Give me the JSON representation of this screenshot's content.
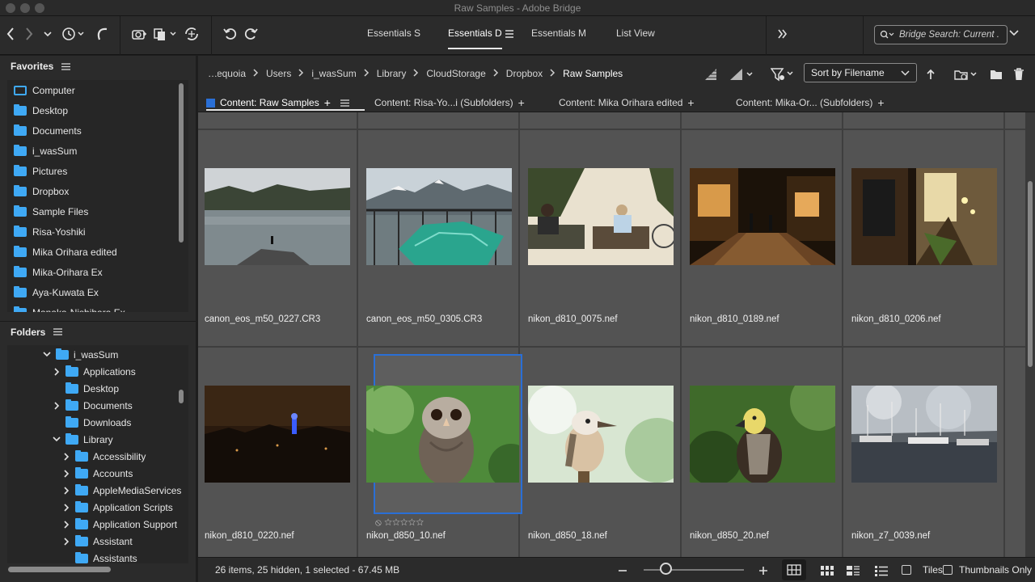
{
  "window": {
    "title": "Raw Samples - Adobe Bridge"
  },
  "toolbar": {
    "workspaces": [
      {
        "label": "Essentials S"
      },
      {
        "label": "Essentials D"
      },
      {
        "label": "Essentials M"
      },
      {
        "label": "List View"
      }
    ],
    "search_placeholder": "Bridge Search: Current ."
  },
  "favorites": {
    "title": "Favorites",
    "items": [
      {
        "label": "Computer",
        "icon": "computer-icon"
      },
      {
        "label": "Desktop",
        "icon": "folder-icon"
      },
      {
        "label": "Documents",
        "icon": "folder-icon"
      },
      {
        "label": "i_wasSum",
        "icon": "home-folder-icon"
      },
      {
        "label": "Pictures",
        "icon": "folder-icon"
      },
      {
        "label": "Dropbox",
        "icon": "folder-icon"
      },
      {
        "label": "Sample Files",
        "icon": "folder-icon"
      },
      {
        "label": "Risa-Yoshiki",
        "icon": "folder-icon"
      },
      {
        "label": "Mika Orihara edited",
        "icon": "folder-icon"
      },
      {
        "label": "Mika-Orihara Ex",
        "icon": "folder-icon"
      },
      {
        "label": "Aya-Kuwata Ex",
        "icon": "folder-icon"
      },
      {
        "label": "Manaka-Nishihara Ex",
        "icon": "folder-icon"
      }
    ]
  },
  "folders": {
    "title": "Folders",
    "items": [
      {
        "label": "i_wasSum",
        "expanded": true
      },
      {
        "label": "Applications",
        "expanded": false
      },
      {
        "label": "Desktop",
        "expanded": null
      },
      {
        "label": "Documents",
        "expanded": false
      },
      {
        "label": "Downloads",
        "expanded": null
      },
      {
        "label": "Library",
        "expanded": true
      },
      {
        "label": "Accessibility",
        "expanded": false
      },
      {
        "label": "Accounts",
        "expanded": false
      },
      {
        "label": "AppleMediaServices",
        "expanded": false
      },
      {
        "label": "Application Scripts",
        "expanded": false
      },
      {
        "label": "Application Support",
        "expanded": false
      },
      {
        "label": "Assistant",
        "expanded": false
      },
      {
        "label": "Assistants",
        "expanded": null
      }
    ]
  },
  "breadcrumb": [
    "Sequoia",
    "Users",
    "i_wasSum",
    "Library",
    "CloudStorage",
    "Dropbox",
    "Raw Samples"
  ],
  "sort": {
    "label": "Sort by Filename"
  },
  "content_tabs": [
    {
      "label": "Content: Raw Samples"
    },
    {
      "label": "Content: Risa-Yo...i (Subfolders)"
    },
    {
      "label": "Content: Mika Orihara edited"
    },
    {
      "label": "Content: Mika-Or... (Subfolders)"
    }
  ],
  "thumbnails": [
    {
      "filename": "canon_eos_m50_0227.CR3",
      "scene": "lake-mountains"
    },
    {
      "filename": "canon_eos_m50_0305.CR3",
      "scene": "mountain-balcony"
    },
    {
      "filename": "nikon_d810_0075.nef",
      "scene": "park-bench"
    },
    {
      "filename": "nikon_d810_0189.nef",
      "scene": "night-street"
    },
    {
      "filename": "nikon_d810_0206.nef",
      "scene": "night-alley"
    },
    {
      "filename": "nikon_d810_0220.nef",
      "scene": "night-city"
    },
    {
      "filename": "nikon_d850_10.nef",
      "scene": "owl",
      "selected": true,
      "rating": "0 stars"
    },
    {
      "filename": "nikon_d850_18.nef",
      "scene": "kookaburra"
    },
    {
      "filename": "nikon_d850_20.nef",
      "scene": "eagle"
    },
    {
      "filename": "nikon_z7_0039.nef",
      "scene": "harbor"
    }
  ],
  "status": {
    "summary": "26 items, 25 hidden, 1 selected - 67.45 MB",
    "thumbnail_size_fraction": 0.17,
    "tiles_label": "Tiles",
    "thumbnails_only_label": "Thumbnails Only"
  },
  "colors": {
    "accent": "#2a6fd6",
    "folder": "#3fa9f5",
    "panel": "#2b2b2b",
    "content_bg": "#535353"
  }
}
